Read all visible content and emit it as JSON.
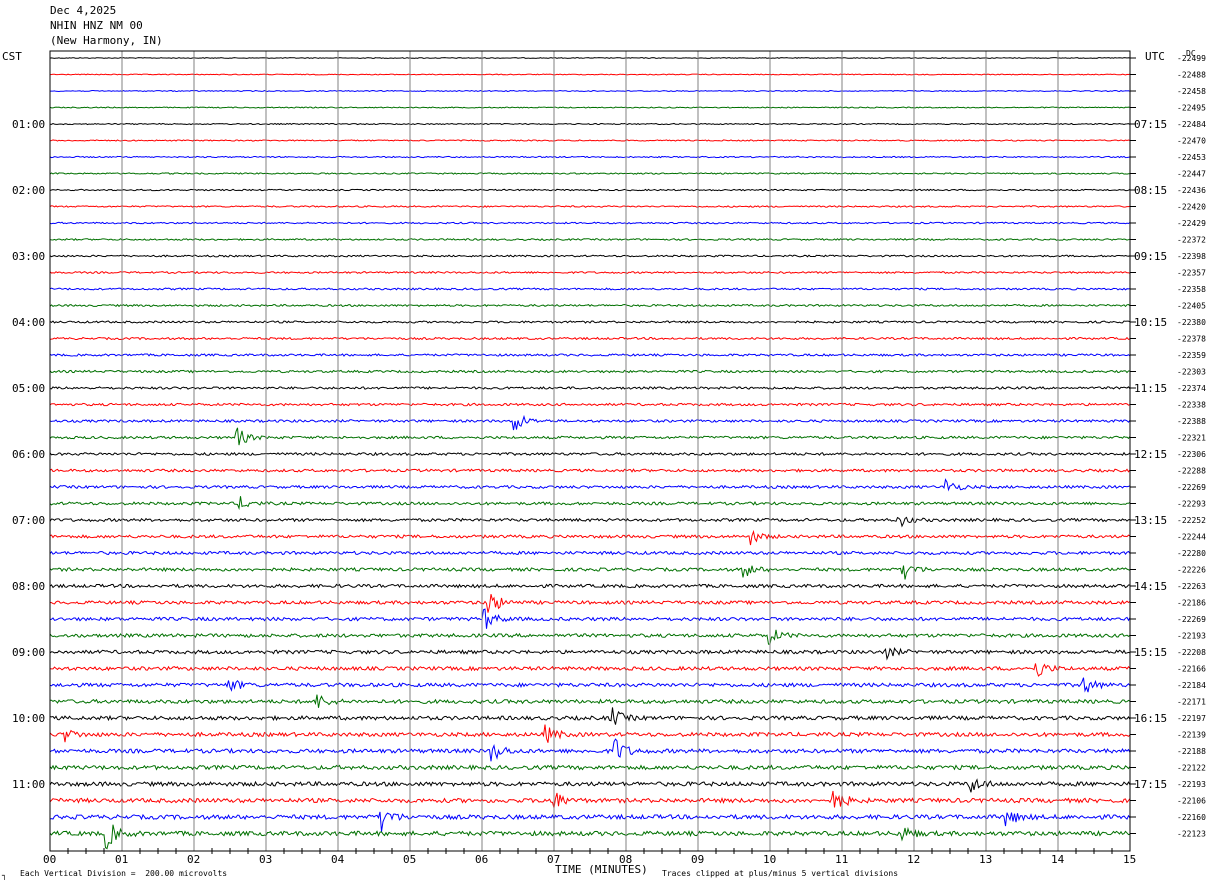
{
  "header": {
    "date": "Dec 4,2025",
    "station": "NHIN HNZ NM 00",
    "location": "(New Harmony, IN)"
  },
  "left_tz": "CST",
  "right_tz": "UTC",
  "dc_label": "DC",
  "footer": {
    "scale": "Each Vertical Division =  200.00 microvolts",
    "clip": "Traces clipped at plus/minus 5 vertical divisions",
    "corner": "┐"
  },
  "chart_data": {
    "type": "line",
    "title": "",
    "xlabel": "TIME (MINUTES)",
    "xlim": [
      0,
      15
    ],
    "x_ticks": [
      "00",
      "01",
      "02",
      "03",
      "04",
      "05",
      "06",
      "07",
      "08",
      "09",
      "10",
      "11",
      "12",
      "13",
      "14",
      "15"
    ],
    "trace_colors": [
      "#000000",
      "#ff0000",
      "#0000ff",
      "#007000"
    ],
    "trace_count": 48,
    "left_time_labels": [
      "01:00",
      "02:00",
      "03:00",
      "04:00",
      "05:00",
      "06:00",
      "07:00",
      "08:00",
      "09:00",
      "10:00",
      "11:00"
    ],
    "right_time_labels": [
      "07:15",
      "08:15",
      "09:15",
      "10:15",
      "11:15",
      "12:15",
      "13:15",
      "14:15",
      "15:15",
      "16:15",
      "17:15"
    ],
    "dc_offsets": [
      "-22499",
      "-22488",
      "-22458",
      "-22495",
      "-22484",
      "-22470",
      "-22453",
      "-22447",
      "-22436",
      "-22420",
      "-22429",
      "-22372",
      "-22398",
      "-22357",
      "-22358",
      "-22405",
      "-22380",
      "-22378",
      "-22359",
      "-22303",
      "-22374",
      "-22338",
      "-22388",
      "-22321",
      "-22306",
      "-22288",
      "-22269",
      "-22293",
      "-22252",
      "-22244",
      "-22280",
      "-22226",
      "-22263",
      "-22186",
      "-22269",
      "-22193",
      "-22208",
      "-22166",
      "-22184",
      "-22171",
      "-22197",
      "-22139",
      "-22188",
      "-22122",
      "-22193",
      "-22106",
      "-22160",
      "-22123"
    ],
    "events": [
      {
        "trace": 22,
        "minute": 6.45,
        "amp": 3.5
      },
      {
        "trace": 23,
        "minute": 2.6,
        "amp": 3.0
      },
      {
        "trace": 26,
        "minute": 12.45,
        "amp": 2.5
      },
      {
        "trace": 27,
        "minute": 2.65,
        "amp": 1.8
      },
      {
        "trace": 28,
        "minute": 11.8,
        "amp": 2.0
      },
      {
        "trace": 29,
        "minute": 9.7,
        "amp": 2.8
      },
      {
        "trace": 31,
        "minute": 9.65,
        "amp": 2.2
      },
      {
        "trace": 31,
        "minute": 11.85,
        "amp": 3.2
      },
      {
        "trace": 33,
        "minute": 6.1,
        "amp": 4.0
      },
      {
        "trace": 34,
        "minute": 6.05,
        "amp": 3.0
      },
      {
        "trace": 35,
        "minute": 10.0,
        "amp": 2.5
      },
      {
        "trace": 36,
        "minute": 11.6,
        "amp": 2.0
      },
      {
        "trace": 37,
        "minute": 13.7,
        "amp": 3.0
      },
      {
        "trace": 38,
        "minute": 2.5,
        "amp": 2.0
      },
      {
        "trace": 38,
        "minute": 14.35,
        "amp": 3.0
      },
      {
        "trace": 39,
        "minute": 3.7,
        "amp": 2.5
      },
      {
        "trace": 40,
        "minute": 7.8,
        "amp": 3.0
      },
      {
        "trace": 41,
        "minute": 0.2,
        "amp": 2.0
      },
      {
        "trace": 41,
        "minute": 6.9,
        "amp": 2.5
      },
      {
        "trace": 42,
        "minute": 7.85,
        "amp": 4.0
      },
      {
        "trace": 42,
        "minute": 6.15,
        "amp": 3.0
      },
      {
        "trace": 44,
        "minute": 12.8,
        "amp": 2.5
      },
      {
        "trace": 45,
        "minute": 6.95,
        "amp": 4.0
      },
      {
        "trace": 45,
        "minute": 10.9,
        "amp": 3.5
      },
      {
        "trace": 46,
        "minute": 4.6,
        "amp": 4.0
      },
      {
        "trace": 46,
        "minute": 13.3,
        "amp": 2.5
      },
      {
        "trace": 47,
        "minute": 0.8,
        "amp": 4.0
      },
      {
        "trace": 47,
        "minute": 11.85,
        "amp": 2.0
      }
    ]
  }
}
